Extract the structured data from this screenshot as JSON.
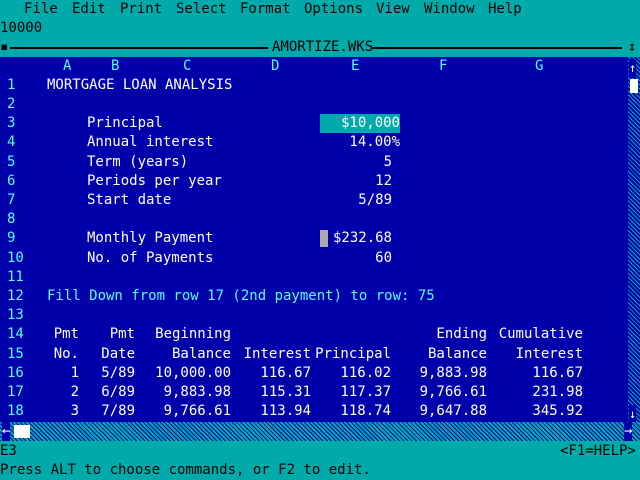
{
  "menu": [
    "File",
    "Edit",
    "Print",
    "Select",
    "Format",
    "Options",
    "View",
    "Window",
    "Help"
  ],
  "entry_line": "10000",
  "window_title": "AMORTIZE.WKS",
  "columns": [
    "A",
    "B",
    "C",
    "D",
    "E",
    "F",
    "G"
  ],
  "rows": [
    "1",
    "2",
    "3",
    "4",
    "5",
    "6",
    "7",
    "8",
    "9",
    "10",
    "11",
    "12",
    "13",
    "14",
    "15",
    "16",
    "17",
    "18"
  ],
  "sheet": {
    "title": "MORTGAGE LOAN ANALYSIS",
    "principal_label": "Principal",
    "principal_value": "$10,000",
    "interest_label": "Annual interest",
    "interest_value": "14.00%",
    "term_label": "Term (years)",
    "term_value": "5",
    "periods_label": "Periods per year",
    "periods_value": "12",
    "start_label": "Start date",
    "start_value": "5/89",
    "payment_label": "Monthly Payment",
    "payment_value": "$232.68",
    "numpay_label": "No. of Payments",
    "numpay_value": "60",
    "fill_note": "Fill Down from row 17 (2nd payment) to row: 75",
    "hdr_pmt1": "Pmt",
    "hdr_pmt2": "No.",
    "hdr_date1": "Pmt",
    "hdr_date2": "Date",
    "hdr_beg1": "Beginning",
    "hdr_beg2": "Balance",
    "hdr_int2": "Interest",
    "hdr_prin2": "Principal",
    "hdr_end1": "Ending",
    "hdr_end2": "Balance",
    "hdr_cum1": "Cumulative",
    "hdr_cum2": "Interest"
  },
  "payments": [
    {
      "no": "1",
      "date": "5/89",
      "beg": "10,000.00",
      "int": "116.67",
      "prin": "116.02",
      "end": "9,883.98",
      "cum": "116.67"
    },
    {
      "no": "2",
      "date": "6/89",
      "beg": "9,883.98",
      "int": "115.31",
      "prin": "117.37",
      "end": "9,766.61",
      "cum": "231.98"
    },
    {
      "no": "3",
      "date": "7/89",
      "beg": "9,766.61",
      "int": "113.94",
      "prin": "118.74",
      "end": "9,647.88",
      "cum": "345.92"
    }
  ],
  "status": {
    "cell_ref": "E3",
    "help_hint": "<F1=HELP>"
  },
  "help_line": "Press ALT to choose commands, or F2 to edit."
}
